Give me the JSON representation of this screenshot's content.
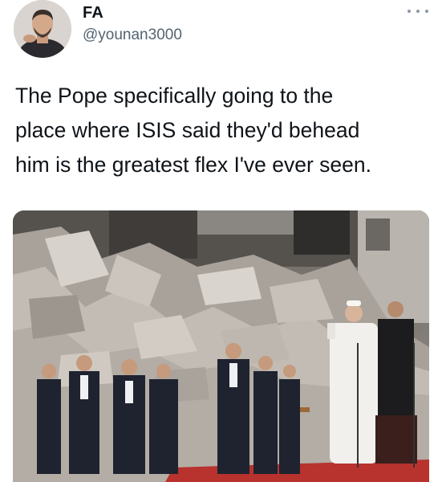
{
  "tweet": {
    "display_name": "FA",
    "handle": "@younan3000",
    "text_lines": [
      "The Pope specifically going to the",
      "place where ISIS said they'd behead",
      "him is the greatest flex I've ever seen."
    ],
    "more_icon": "more-horizontal-icon",
    "avatar_icon": "user-avatar",
    "media_icon": "photo-attachment"
  },
  "colors": {
    "text_primary": "#0f1419",
    "text_secondary": "#536471",
    "icon_muted": "#8b98a5",
    "carpet_red": "#b8322e"
  }
}
